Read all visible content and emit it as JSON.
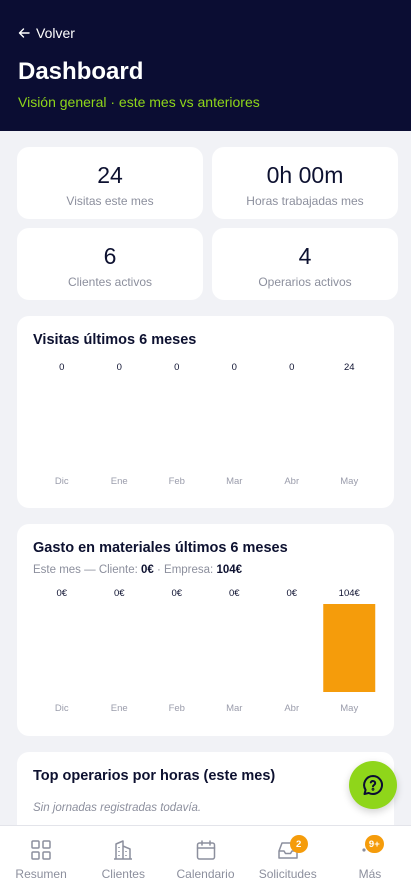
{
  "header": {
    "back_label": "Volver",
    "title": "Dashboard",
    "subtitle": "Visión general · este mes vs anteriores"
  },
  "stats": [
    {
      "value": "24",
      "label": "Visitas este mes"
    },
    {
      "value": "0h 00m",
      "label": "Horas trabajadas mes"
    },
    {
      "value": "6",
      "label": "Clientes activos"
    },
    {
      "value": "4",
      "label": "Operarios activos"
    }
  ],
  "visits_card": {
    "title": "Visitas últimos 6 meses"
  },
  "materials_card": {
    "title": "Gasto en materiales últimos 6 meses",
    "sub_prefix": "Este mes — Cliente: ",
    "client_value": "0€",
    "sub_middle": " · Empresa: ",
    "company_value": "104€"
  },
  "operators_card": {
    "title": "Top operarios por horas (este mes)",
    "empty_text": "Sin jornadas registradas todavía."
  },
  "chart_data": [
    {
      "type": "bar",
      "categories": [
        "Dic",
        "Ene",
        "Feb",
        "Mar",
        "Abr",
        "May"
      ],
      "values": [
        0,
        0,
        0,
        0,
        0,
        24
      ],
      "value_labels": [
        "0",
        "0",
        "0",
        "0",
        "0",
        "24"
      ],
      "bar_color": "#f59c0b",
      "bars_visible": false
    },
    {
      "type": "bar",
      "categories": [
        "Dic",
        "Ene",
        "Feb",
        "Mar",
        "Abr",
        "May"
      ],
      "values": [
        0,
        0,
        0,
        0,
        0,
        104
      ],
      "value_labels": [
        "0€",
        "0€",
        "0€",
        "0€",
        "0€",
        "104€"
      ],
      "bar_color": "#f59c0b",
      "bars_visible": true
    }
  ],
  "fab": {
    "icon": "help-chat-icon"
  },
  "tabbar": [
    {
      "label": "Resumen",
      "icon": "grid-icon",
      "badge": ""
    },
    {
      "label": "Clientes",
      "icon": "building-icon",
      "badge": ""
    },
    {
      "label": "Calendario",
      "icon": "calendar-icon",
      "badge": ""
    },
    {
      "label": "Solicitudes",
      "icon": "inbox-icon",
      "badge": "2"
    },
    {
      "label": "Más",
      "icon": "more-icon",
      "badge": "9+"
    }
  ],
  "colors": {
    "header_bg": "#0b0d33",
    "accent_green": "#8fd61a",
    "bar_orange": "#f59c0b",
    "page_bg": "#f1f2f6"
  }
}
